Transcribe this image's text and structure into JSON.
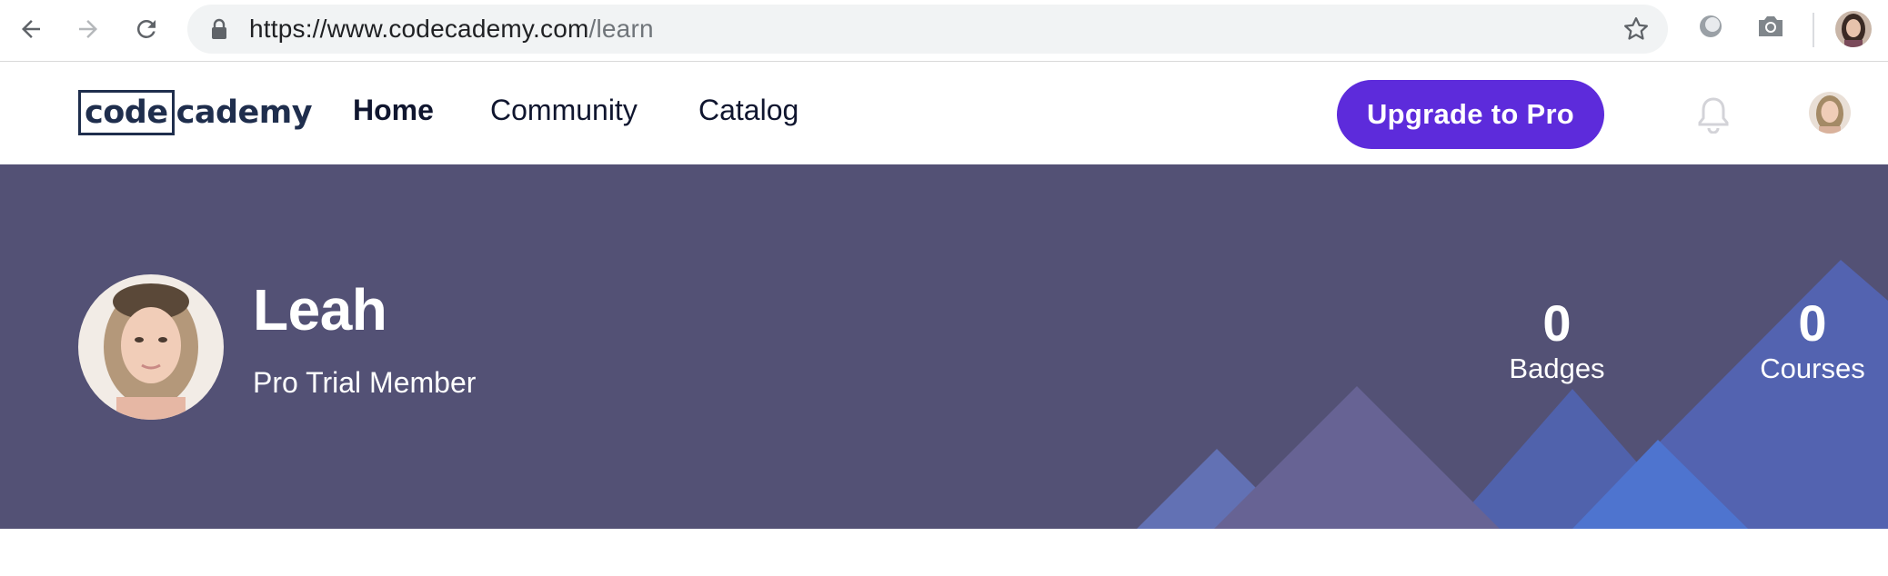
{
  "browser": {
    "url_host": "https://www.codecademy.com",
    "url_path": "/learn",
    "icons": [
      "back-arrow-icon",
      "forward-arrow-icon",
      "reload-icon",
      "lock-icon",
      "star-icon",
      "extension-icon",
      "camera-icon"
    ]
  },
  "site": {
    "logo_box": "code",
    "logo_rest": "cademy",
    "nav": {
      "home": "Home",
      "community": "Community",
      "catalog": "Catalog"
    },
    "upgrade_label": "Upgrade to Pro"
  },
  "profile": {
    "name": "Leah",
    "role": "Pro Trial Member",
    "badges_count": "0",
    "badges_label": "Badges",
    "courses_count": "0",
    "courses_label": "Courses"
  },
  "colors": {
    "accent": "#5d2bdb",
    "hero_bg": "#535175",
    "logo": "#1f2e4d"
  }
}
